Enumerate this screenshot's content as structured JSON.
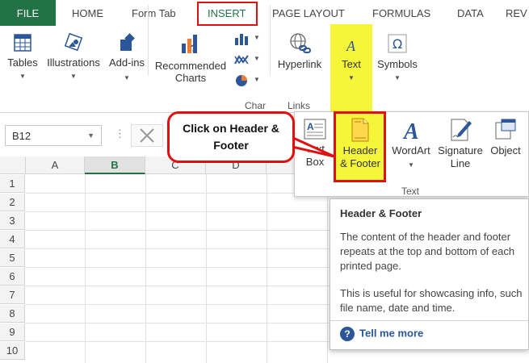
{
  "menu": {
    "tabs": [
      "FILE",
      "HOME",
      "Form Tab",
      "INSERT",
      "PAGE LAYOUT",
      "FORMULAS",
      "DATA",
      "REV"
    ]
  },
  "ribbon": {
    "tables": "Tables",
    "illustrations": "Illustrations",
    "addins": "Add-ins",
    "recommended_charts": "Recommended Charts",
    "hyperlink": "Hyperlink",
    "text": "Text",
    "symbols": "Symbols",
    "group_charts": "Char",
    "group_links": "Links"
  },
  "formula_bar": {
    "name_box_value": "B12"
  },
  "grid": {
    "columns": [
      "A",
      "B",
      "C",
      "D"
    ],
    "rows": [
      "1",
      "2",
      "3",
      "4",
      "5",
      "6",
      "7",
      "8",
      "9",
      "10"
    ],
    "selected_column": "B"
  },
  "text_dropdown": {
    "text_box": "Text Box",
    "header_footer": "Header & Footer",
    "wordart": "WordArt",
    "signature_line": "Signature Line",
    "object": "Object",
    "group_label": "Text"
  },
  "tooltip": {
    "title": "Header & Footer",
    "body1": "The content of the header and footer repeats at the top and bottom of each printed page.",
    "body2": "This is useful for showcasing info, such file name, date and time.",
    "help": "Tell me more"
  },
  "callout": {
    "text": "Click on Header & Footer"
  },
  "colors": {
    "accent": "#217346",
    "highlight_yellow": "#f5f53a",
    "annotation_red": "#e01010",
    "help_blue": "#2b579a"
  }
}
